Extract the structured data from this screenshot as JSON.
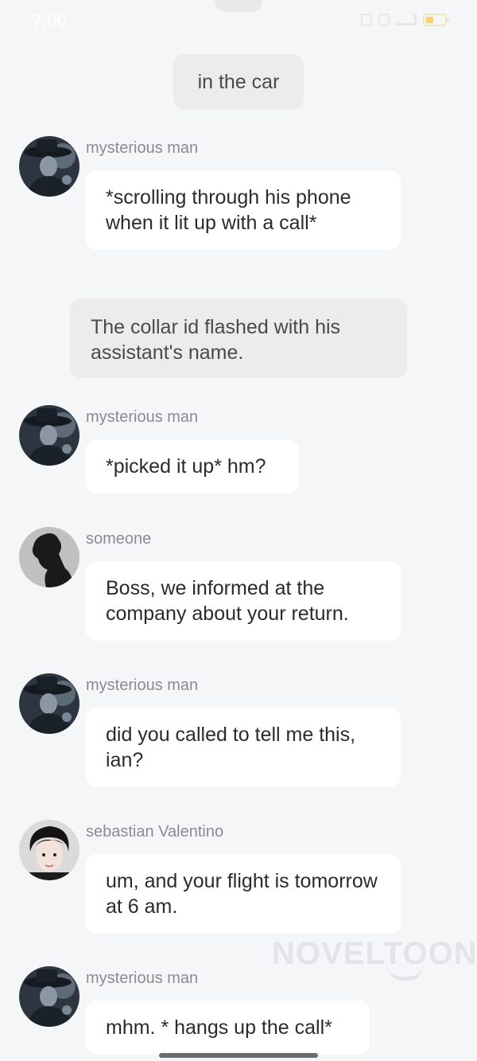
{
  "status_bar": {
    "time": "7:00",
    "icons": [
      "vibrate-icon",
      "sim-icon",
      "signal-icon",
      "battery-icon"
    ]
  },
  "scene_label": "in the car",
  "narration": "The collar id flashed with his assistant's name.",
  "messages": [
    {
      "name": "mysterious man",
      "text": "*scrolling through his phone when it lit up with a call*",
      "avatar": "dark-hat-portrait"
    },
    {
      "name": "mysterious man",
      "text": "*picked it up* hm?",
      "avatar": "dark-hat-portrait"
    },
    {
      "name": "someone",
      "text": "Boss, we informed at the company about your return.",
      "avatar": "silhouette"
    },
    {
      "name": "mysterious man",
      "text": "did you called to tell me this, ian?",
      "avatar": "dark-hat-portrait"
    },
    {
      "name": "sebastian Valentino",
      "text": "um, and your flight is tomorrow at 6 am.",
      "avatar": "young-man-portrait"
    },
    {
      "name": "mysterious man",
      "text": "mhm. * hangs up the call*",
      "avatar": "dark-hat-portrait"
    }
  ],
  "watermark": "NOVELTOON",
  "colors": {
    "background": "#f5f6f8",
    "bubble": "#ffffff",
    "narration_bubble": "#ececee",
    "name_text": "#8b8b8f"
  }
}
